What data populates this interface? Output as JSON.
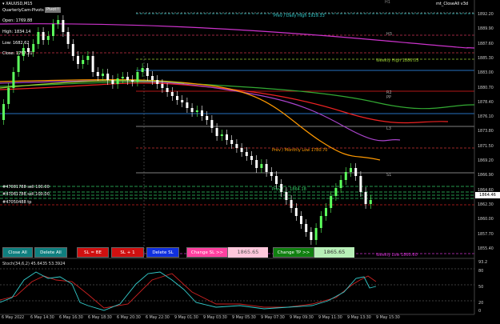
{
  "header": {
    "symbol": "XAUUSD,M15",
    "indicator_name": "QuarterlyCam-Pivots",
    "indicator_short": "Pivot!!",
    "ea_name": "mt_CloseAll v3d"
  },
  "ohlc": {
    "open": "Open: 1769.88",
    "high": "High: 1834.14",
    "low": "Low: 1682.62",
    "close": "Close: 1757.21"
  },
  "levels": {
    "h1": "H1",
    "h3": "H3",
    "r2": "R2",
    "pp": "PP",
    "l3": "L3",
    "s1": "S1",
    "prev_daily_high": "Prev / Daily High 1929.33",
    "weekly_high": "Weekly High 1886.05",
    "prev_monthly_low": "Prev / Monthly Low 1780.70",
    "weekly_low": "Weekly Low 1860.60",
    "lower_mid_label": "Prev / ... 1864.18"
  },
  "orders": [
    "#47081788 sell 100.00",
    "#47081788 sell 100.00",
    "#47050488 tp"
  ],
  "buttons": {
    "close_all": "Close All",
    "delete_all": "Delete All",
    "sl_be": "SL = BE",
    "sl_plus1": "SL + 1",
    "delete_sl": "Delete SL",
    "change_sl": "Change SL >>",
    "sl_value": "1865.65",
    "change_tp": "Change TP >>",
    "tp_value": "1865.65"
  },
  "stoch": {
    "label": "Stoch(34,6,2) 45.6435 53.3924",
    "levels": [
      "93.2",
      "80",
      "50",
      "20",
      "0"
    ]
  },
  "price_axis": [
    "1892.20",
    "1889.90",
    "1887.60",
    "1885.30",
    "1883.00",
    "1880.70",
    "1878.40",
    "1876.10",
    "1873.80",
    "1871.50",
    "1869.20",
    "1866.90",
    "1864.60",
    "1862.30",
    "1860.00",
    "1857.70",
    "1855.40"
  ],
  "current_price": "1864.46",
  "time_axis": [
    "6 May 2022",
    "6 May 14:30",
    "6 May 16:30",
    "6 May 18:30",
    "6 May 20:30",
    "6 May 22:30",
    "9 May 01:30",
    "9 May 03:30",
    "9 May 05:30",
    "9 May 07:30",
    "9 May 09:30",
    "9 May 11:30",
    "9 May 13:30",
    "9 May 15:30"
  ],
  "colors": {
    "bull": "#5cff5c",
    "bear": "#ffffff",
    "ma_magenta": "#cc33cc",
    "ma_green": "#33aa33",
    "ma_red": "#ee2222",
    "ma_orange": "#ff9900",
    "ma_purple": "#aa44cc",
    "ma_yellowgreen": "#99cc33",
    "blue_level": "#3399ff",
    "teal": "#33cccc",
    "btn_teal": "#0f7f7f",
    "btn_red": "#d01010",
    "btn_blue": "#1030e0",
    "btn_pink": "#ff40a0",
    "btn_green": "#108010"
  }
}
